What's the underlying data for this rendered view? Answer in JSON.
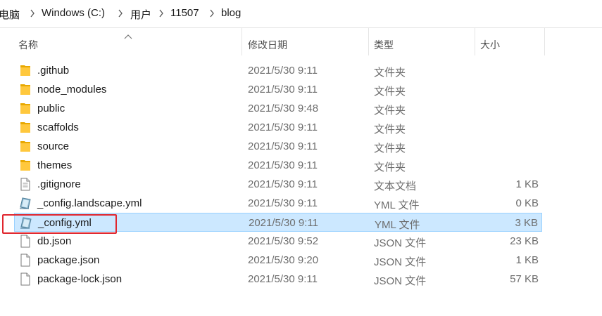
{
  "breadcrumb": {
    "items": [
      "电脑",
      "Windows (C:)",
      "用户",
      "11507",
      "blog"
    ]
  },
  "columns": {
    "name": "名称",
    "date": "修改日期",
    "type": "类型",
    "size": "大小"
  },
  "files": [
    {
      "name": ".github",
      "date": "2021/5/30 9:11",
      "type": "文件夹",
      "size": "",
      "icon": "folder-icon"
    },
    {
      "name": "node_modules",
      "date": "2021/5/30 9:11",
      "type": "文件夹",
      "size": "",
      "icon": "folder-icon"
    },
    {
      "name": "public",
      "date": "2021/5/30 9:48",
      "type": "文件夹",
      "size": "",
      "icon": "folder-icon"
    },
    {
      "name": "scaffolds",
      "date": "2021/5/30 9:11",
      "type": "文件夹",
      "size": "",
      "icon": "folder-icon"
    },
    {
      "name": "source",
      "date": "2021/5/30 9:11",
      "type": "文件夹",
      "size": "",
      "icon": "folder-icon"
    },
    {
      "name": "themes",
      "date": "2021/5/30 9:11",
      "type": "文件夹",
      "size": "",
      "icon": "folder-icon"
    },
    {
      "name": ".gitignore",
      "date": "2021/5/30 9:11",
      "type": "文本文档",
      "size": "1 KB",
      "icon": "text-file-icon"
    },
    {
      "name": "_config.landscape.yml",
      "date": "2021/5/30 9:11",
      "type": "YML 文件",
      "size": "0 KB",
      "icon": "yml-file-icon"
    },
    {
      "name": "_config.yml",
      "date": "2021/5/30 9:11",
      "type": "YML 文件",
      "size": "3 KB",
      "icon": "yml-file-icon",
      "selected": true
    },
    {
      "name": "db.json",
      "date": "2021/5/30 9:52",
      "type": "JSON 文件",
      "size": "23 KB",
      "icon": "json-file-icon"
    },
    {
      "name": "package.json",
      "date": "2021/5/30 9:20",
      "type": "JSON 文件",
      "size": "1 KB",
      "icon": "json-file-icon"
    },
    {
      "name": "package-lock.json",
      "date": "2021/5/30 9:11",
      "type": "JSON 文件",
      "size": "57 KB",
      "icon": "json-file-icon"
    }
  ],
  "colors": {
    "selection": "#cce8ff",
    "highlight": "#e0262e",
    "folder": "#ffc83d"
  }
}
